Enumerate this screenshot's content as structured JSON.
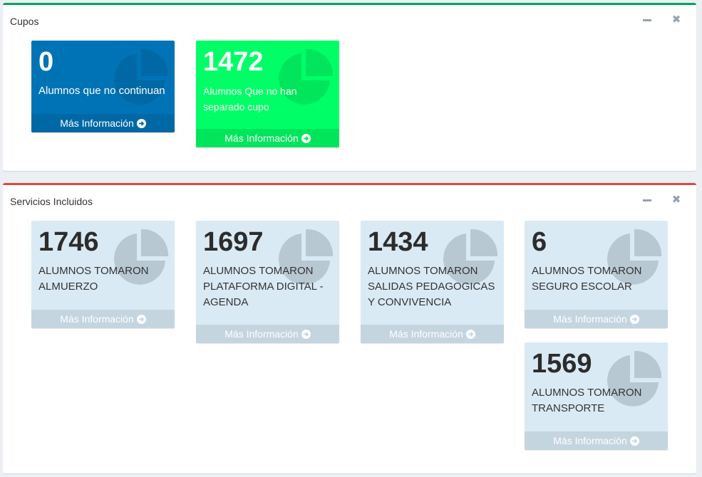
{
  "colors": {
    "cupos_border": "#00a65a",
    "servicios_border": "#dd4b39",
    "blue_box": "#0073b7",
    "green_box": "#00ff66",
    "light_box": "#daeaf4"
  },
  "cupos": {
    "title": "Cupos",
    "boxes": [
      {
        "number": "0",
        "label": "Alumnos que no continuan",
        "footer": "Más Información",
        "icon": "pie-chart-icon"
      },
      {
        "number": "1472",
        "label": "Alumnos Que no han separado cupo",
        "footer": "Más Información",
        "icon": "pie-chart-icon"
      }
    ]
  },
  "servicios": {
    "title": "Servicios Incluidos",
    "boxes": [
      {
        "number": "1746",
        "label": "ALUMNOS TOMARON ALMUERZO",
        "footer": "Más Información",
        "icon": "pie-chart-icon"
      },
      {
        "number": "1697",
        "label": "ALUMNOS TOMARON PLATAFORMA DIGITAL - AGENDA",
        "footer": "Más Información",
        "icon": "pie-chart-icon"
      },
      {
        "number": "1434",
        "label": "ALUMNOS TOMARON SALIDAS PEDAGOGICAS Y CONVIVENCIA",
        "footer": "Más Información",
        "icon": "pie-chart-icon"
      },
      {
        "number": "6",
        "label": "ALUMNOS TOMARON SEGURO ESCOLAR",
        "footer": "Más Información",
        "icon": "pie-chart-icon"
      },
      {
        "number": "1569",
        "label": "ALUMNOS TOMARON TRANSPORTE",
        "footer": "Más Información",
        "icon": "pie-chart-icon"
      }
    ]
  },
  "tools": {
    "minimize_icon": "minus-icon",
    "close_icon": "times-icon",
    "close_glyph": "✖"
  }
}
